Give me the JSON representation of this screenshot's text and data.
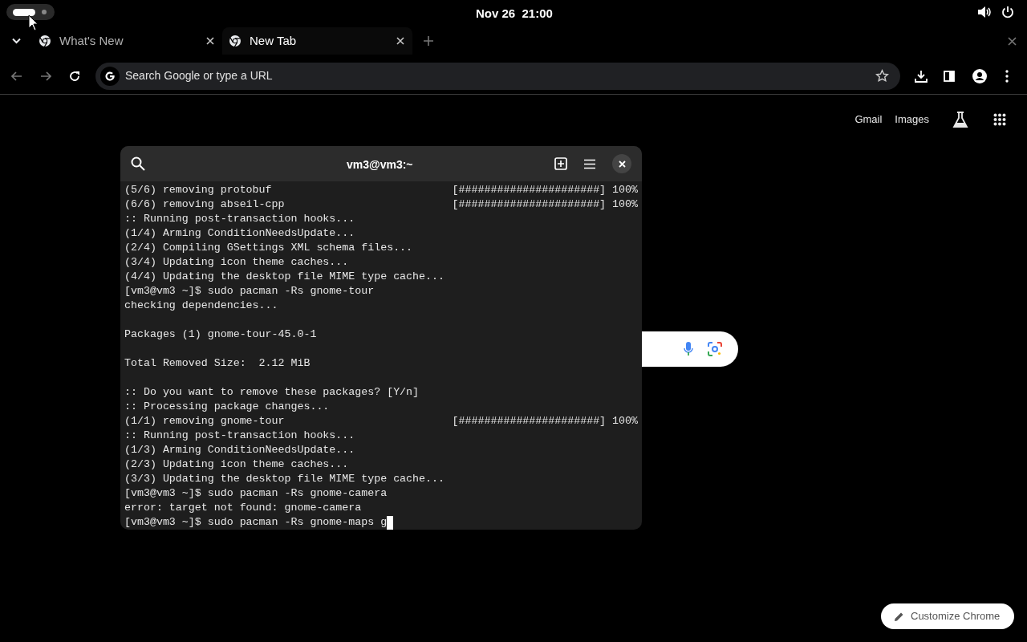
{
  "top_bar": {
    "clock": "Nov 26  21:00"
  },
  "tabs": [
    {
      "title": "What's New",
      "selected": false
    },
    {
      "title": "New Tab",
      "selected": true
    }
  ],
  "omnibox": {
    "placeholder": "Search Google or type a URL"
  },
  "new_tab_page": {
    "links": [
      "Gmail",
      "Images"
    ],
    "customize_button": "Customize Chrome"
  },
  "terminal": {
    "title": "vm3@vm3:~",
    "cursor": true,
    "lines": [
      {
        "kind": "progress",
        "text": "(5/6) removing protobuf",
        "progress": "[######################] 100%"
      },
      {
        "kind": "progress",
        "text": "(6/6) removing abseil-cpp",
        "progress": "[######################] 100%"
      },
      {
        "kind": "text",
        "text": ":: Running post-transaction hooks..."
      },
      {
        "kind": "text",
        "text": "(1/4) Arming ConditionNeedsUpdate..."
      },
      {
        "kind": "text",
        "text": "(2/4) Compiling GSettings XML schema files..."
      },
      {
        "kind": "text",
        "text": "(3/4) Updating icon theme caches..."
      },
      {
        "kind": "text",
        "text": "(4/4) Updating the desktop file MIME type cache..."
      },
      {
        "kind": "text",
        "text": "[vm3@vm3 ~]$ sudo pacman -Rs gnome-tour"
      },
      {
        "kind": "text",
        "text": "checking dependencies..."
      },
      {
        "kind": "blank"
      },
      {
        "kind": "text",
        "text": "Packages (1) gnome-tour-45.0-1"
      },
      {
        "kind": "blank"
      },
      {
        "kind": "text",
        "text": "Total Removed Size:  2.12 MiB"
      },
      {
        "kind": "blank"
      },
      {
        "kind": "text",
        "text": ":: Do you want to remove these packages? [Y/n]"
      },
      {
        "kind": "text",
        "text": ":: Processing package changes..."
      },
      {
        "kind": "progress",
        "text": "(1/1) removing gnome-tour",
        "progress": "[######################] 100%"
      },
      {
        "kind": "text",
        "text": ":: Running post-transaction hooks..."
      },
      {
        "kind": "text",
        "text": "(1/3) Arming ConditionNeedsUpdate..."
      },
      {
        "kind": "text",
        "text": "(2/3) Updating icon theme caches..."
      },
      {
        "kind": "text",
        "text": "(3/3) Updating the desktop file MIME type cache..."
      },
      {
        "kind": "text",
        "text": "[vm3@vm3 ~]$ sudo pacman -Rs gnome-camera"
      },
      {
        "kind": "text",
        "text": "error: target not found: gnome-camera"
      },
      {
        "kind": "text",
        "text": "[vm3@vm3 ~]$ sudo pacman -Rs gnome-maps g"
      }
    ]
  }
}
